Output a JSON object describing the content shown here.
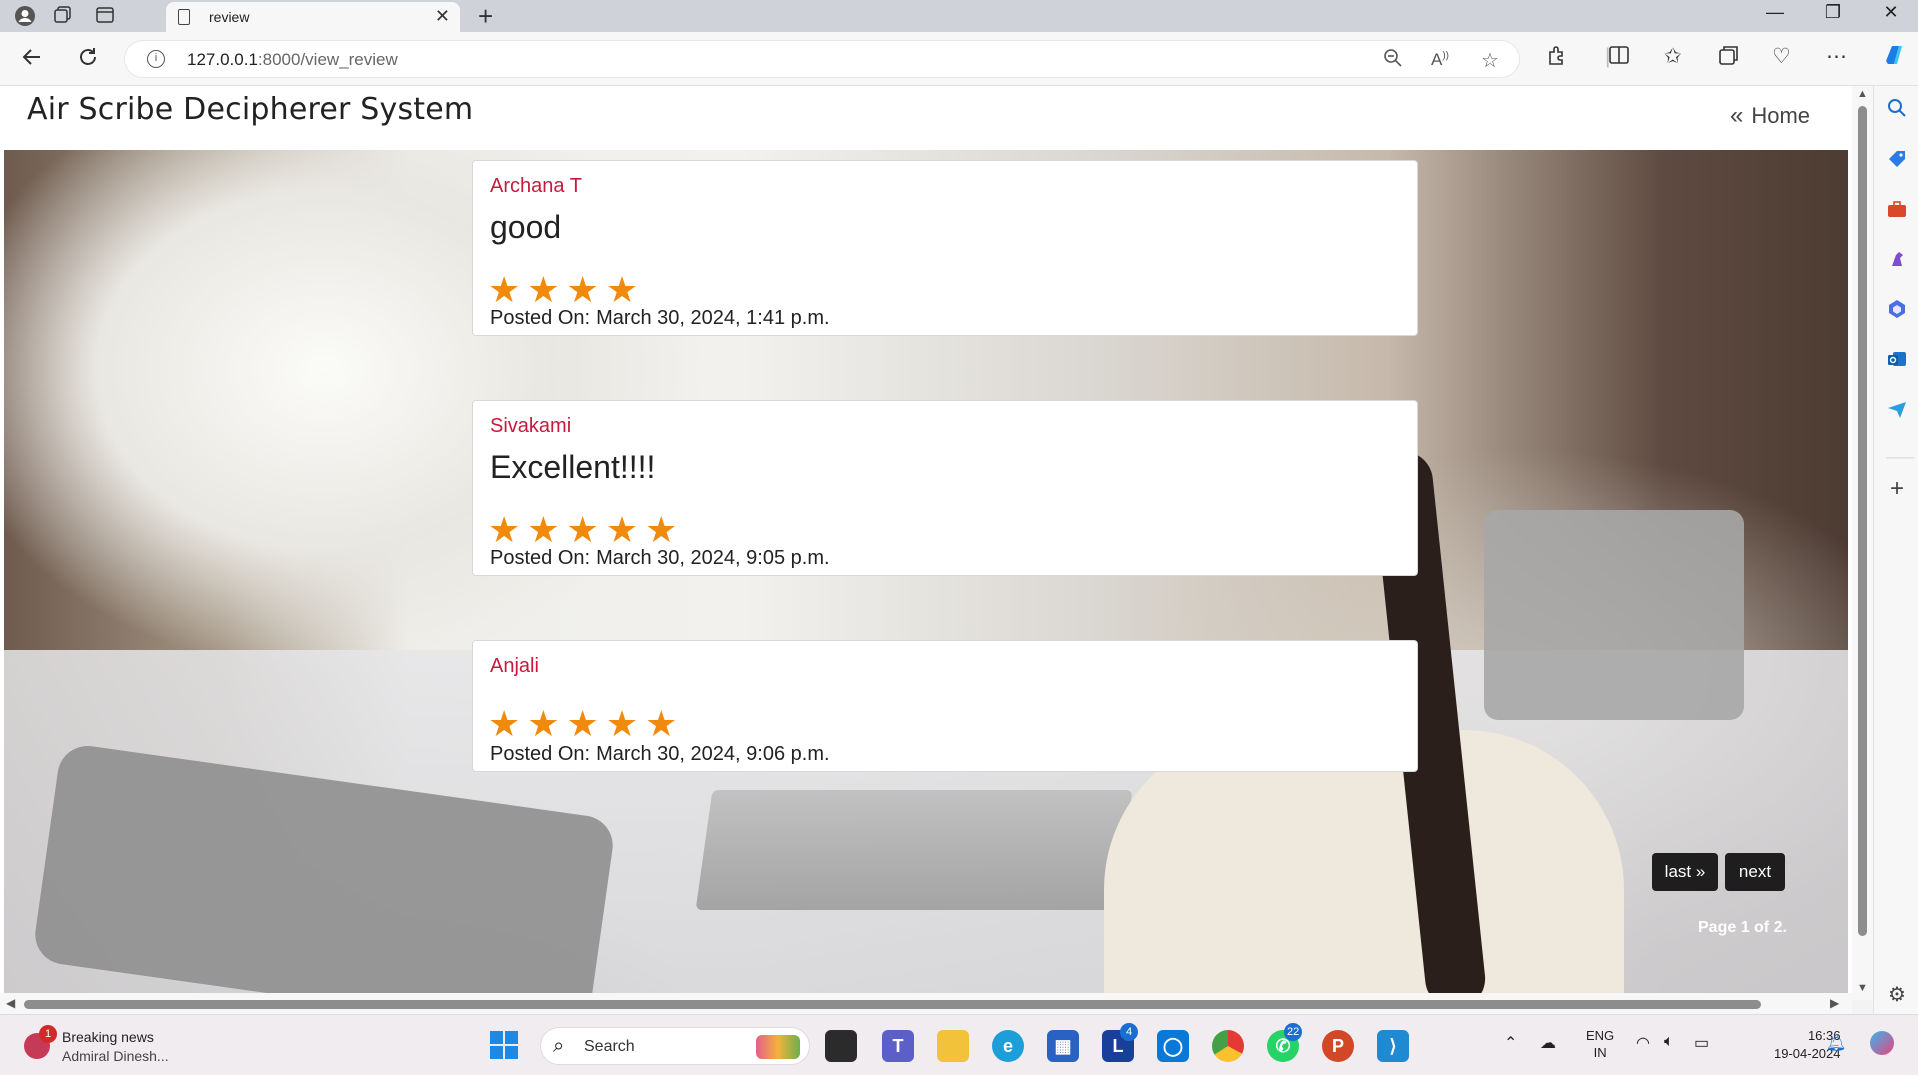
{
  "browser": {
    "tab_title": "review",
    "url_host": "127.0.0.1",
    "url_path": ":8000/view_review"
  },
  "site": {
    "brand": "Air Scribe Decipherer System",
    "home_label": "Home"
  },
  "reviews": [
    {
      "name": "Archana T",
      "text": "good",
      "stars": "★★★★",
      "rating": 4,
      "posted_label": "Posted On:",
      "posted": "March 30, 2024, 1:41 p.m."
    },
    {
      "name": "Sivakami",
      "text": "Excellent!!!!",
      "stars": "★★★★★",
      "rating": 5,
      "posted_label": "Posted On:",
      "posted": "March 30, 2024, 9:05 p.m."
    },
    {
      "name": "Anjali",
      "text": "",
      "stars": "★★★★★",
      "rating": 5,
      "posted_label": "Posted On:",
      "posted": "March 30, 2024, 9:06 p.m."
    }
  ],
  "pagination": {
    "last_label": "last »",
    "next_label": "next",
    "page_info": "Page 1 of 2."
  },
  "taskbar": {
    "news_badge": "1",
    "news_title": "Breaking news",
    "news_sub": "Admiral Dinesh...",
    "search_placeholder": "Search",
    "l_badge": "4",
    "whatsapp_badge": "22",
    "lang_line1": "ENG",
    "lang_line2": "IN",
    "time": "16:36",
    "date": "19-04-2024"
  },
  "colors": {
    "reviewer_name": "#c8193c",
    "star": "#f08a0c",
    "pager_button": "#1e1e1e"
  }
}
